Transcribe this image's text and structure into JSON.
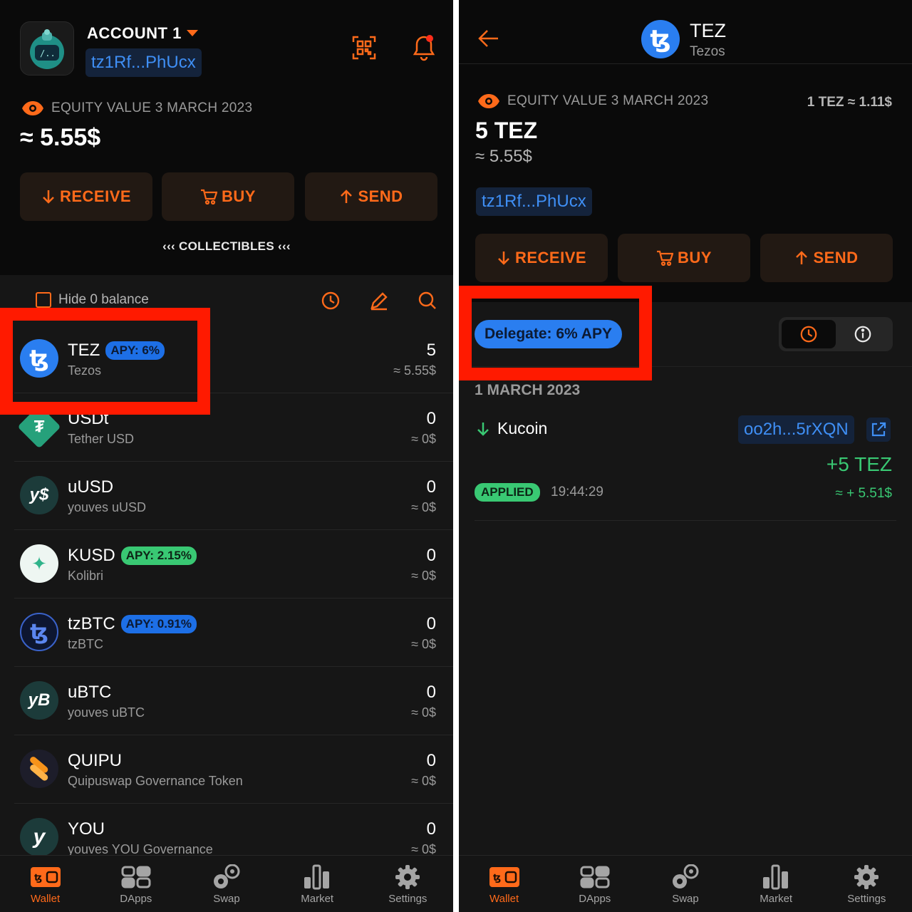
{
  "colors": {
    "accent": "#ff6a1a",
    "tezos_blue": "#2a7ef0",
    "green": "#39c873",
    "highlight_red": "#ff1a00"
  },
  "left": {
    "header": {
      "account_name": "ACCOUNT 1",
      "address": "tz1Rf...PhUcx"
    },
    "equity": {
      "label": "EQUITY VALUE 3 MARCH 2023",
      "value": "≈ 5.55$"
    },
    "actions": {
      "receive": "RECEIVE",
      "buy": "BUY",
      "send": "SEND"
    },
    "collectibles": "‹‹‹ COLLECTIBLES ‹‹‹",
    "hide_zero": "Hide 0 balance",
    "tokens": [
      {
        "symbol": "TEZ",
        "name": "Tezos",
        "apy": "APY: 6%",
        "balance": "5",
        "usd": "≈ 5.55$",
        "glyph": "ꜩ"
      },
      {
        "symbol": "USDt",
        "name": "Tether USD",
        "apy": "",
        "balance": "0",
        "usd": "≈ 0$",
        "glyph": "₮"
      },
      {
        "symbol": "uUSD",
        "name": "youves uUSD",
        "apy": "",
        "balance": "0",
        "usd": "≈ 0$",
        "glyph": "y$"
      },
      {
        "symbol": "KUSD",
        "name": "Kolibri",
        "apy": "APY: 2.15%",
        "balance": "0",
        "usd": "≈ 0$",
        "glyph": "✦"
      },
      {
        "symbol": "tzBTC",
        "name": "tzBTC",
        "apy": "APY: 0.91%",
        "balance": "0",
        "usd": "≈ 0$",
        "glyph": "ꜩ"
      },
      {
        "symbol": "uBTC",
        "name": "youves uBTC",
        "apy": "",
        "balance": "0",
        "usd": "≈ 0$",
        "glyph": "yB"
      },
      {
        "symbol": "QUIPU",
        "name": "Quipuswap Governance Token",
        "apy": "",
        "balance": "0",
        "usd": "≈ 0$",
        "glyph": ""
      },
      {
        "symbol": "YOU",
        "name": "youves YOU Governance",
        "apy": "",
        "balance": "0",
        "usd": "≈ 0$",
        "glyph": "y"
      }
    ]
  },
  "tabs": [
    {
      "label": "Wallet",
      "icon": "wallet-icon"
    },
    {
      "label": "DApps",
      "icon": "dapps-icon"
    },
    {
      "label": "Swap",
      "icon": "swap-icon"
    },
    {
      "label": "Market",
      "icon": "market-icon"
    },
    {
      "label": "Settings",
      "icon": "settings-icon"
    }
  ],
  "right": {
    "header": {
      "symbol": "TEZ",
      "name": "Tezos"
    },
    "equity": {
      "label": "EQUITY VALUE 3 MARCH 2023",
      "rate": "1 TEZ ≈ 1.11$",
      "amount": "5 TEZ",
      "usd": "≈ 5.55$"
    },
    "address": "tz1Rf...PhUcx",
    "actions": {
      "receive": "RECEIVE",
      "buy": "BUY",
      "send": "SEND"
    },
    "delegate": "Delegate: 6% APY",
    "history": {
      "date": "1 MARCH 2023",
      "counterparty": "Kucoin",
      "hash": "oo2h...5rXQN",
      "amount": "+5 TEZ",
      "usd": "≈ + 5.51$",
      "status": "APPLIED",
      "time": "19:44:29"
    }
  }
}
